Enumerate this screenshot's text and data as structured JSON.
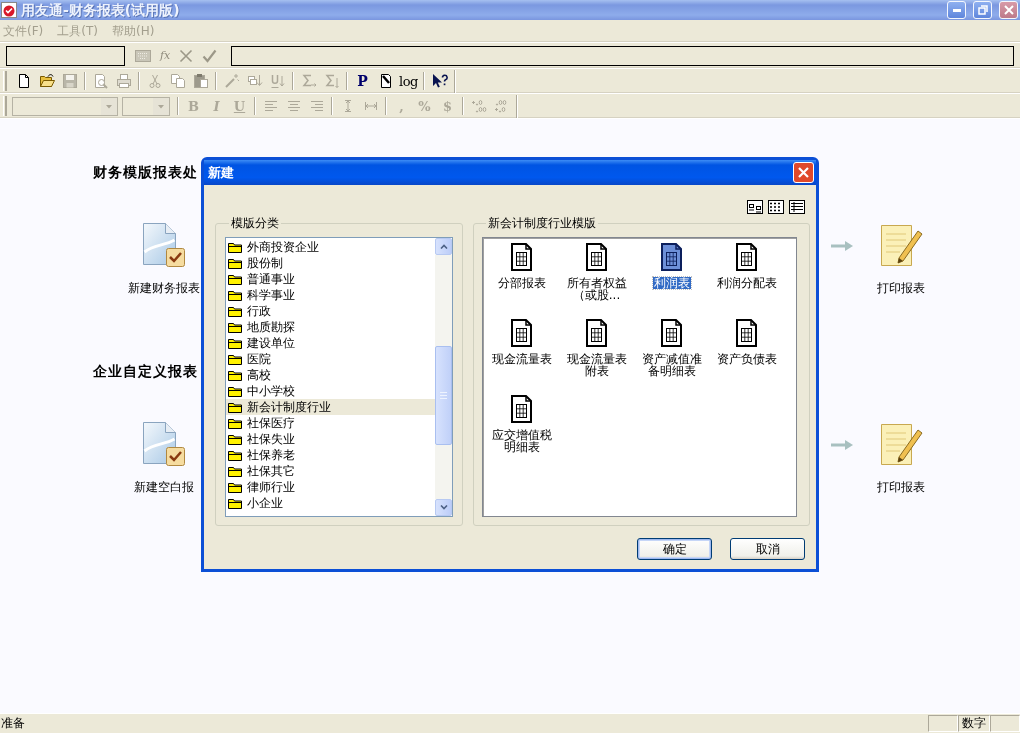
{
  "window": {
    "title": "用友通-财务报表(试用版)",
    "active": false
  },
  "menu": [
    {
      "label": "文件(F)",
      "disabled": true
    },
    {
      "label": "工具(T)",
      "disabled": true
    },
    {
      "label": "帮助(H)",
      "disabled": true
    }
  ],
  "formula_bar": {
    "function_label": "fx",
    "disabled": true
  },
  "standard_toolbar": [
    [
      {
        "kind": "icon",
        "disabled": false
      },
      {
        "kind": "icon",
        "disabled": false
      },
      {
        "kind": "icon",
        "disabled": true
      }
    ],
    [
      {
        "kind": "icon",
        "disabled": true
      },
      {
        "kind": "icon",
        "disabled": true
      }
    ],
    [
      {
        "kind": "icon",
        "disabled": true
      },
      {
        "kind": "icon",
        "disabled": true
      },
      {
        "kind": "icon",
        "disabled": true
      }
    ],
    [
      {
        "kind": "icon",
        "disabled": true
      },
      {
        "kind": "icon",
        "disabled": true
      },
      {
        "kind": "icon",
        "disabled": true
      }
    ],
    [
      {
        "kind": "icon",
        "disabled": true
      },
      {
        "kind": "icon",
        "disabled": true
      }
    ],
    [
      {
        "kind": "text",
        "label": "P",
        "disabled": false
      },
      {
        "kind": "icon",
        "disabled": false
      },
      {
        "kind": "text",
        "label": "log",
        "disabled": false
      }
    ],
    [
      {
        "kind": "icon",
        "disabled": false
      }
    ]
  ],
  "format_toolbar": [
    [
      {
        "kind": "combo",
        "disabled": true
      },
      {
        "kind": "combo",
        "disabled": true
      }
    ],
    [
      {
        "kind": "text",
        "label": "B",
        "disabled": true
      },
      {
        "kind": "text",
        "label": "I",
        "disabled": true
      },
      {
        "kind": "text",
        "label": "U",
        "disabled": true
      }
    ],
    [
      {
        "kind": "icon",
        "disabled": true
      },
      {
        "kind": "icon",
        "disabled": true
      },
      {
        "kind": "icon",
        "disabled": true
      }
    ],
    [
      {
        "kind": "icon",
        "disabled": true
      },
      {
        "kind": "icon",
        "disabled": true
      }
    ],
    [
      {
        "kind": "text",
        "label": ",",
        "disabled": true
      },
      {
        "kind": "text",
        "label": "%",
        "disabled": true
      },
      {
        "kind": "text",
        "label": "$",
        "disabled": true
      }
    ],
    [
      {
        "kind": "icon",
        "disabled": true
      },
      {
        "kind": "icon",
        "disabled": true
      }
    ]
  ],
  "sections": [
    {
      "heading": "财务模版报表处",
      "start_task": "新建财务报表",
      "end_task": "打印报表"
    },
    {
      "heading": "企业自定义报表",
      "start_task": "新建空白报",
      "end_task": "打印报表"
    }
  ],
  "dialog": {
    "title": "新建",
    "category_group": {
      "label": "模版分类",
      "items": [
        {
          "label": "外商投资企业",
          "selected": false
        },
        {
          "label": "股份制",
          "selected": false
        },
        {
          "label": "普通事业",
          "selected": false
        },
        {
          "label": "科学事业",
          "selected": false
        },
        {
          "label": "行政",
          "selected": false
        },
        {
          "label": "地质勘探",
          "selected": false
        },
        {
          "label": "建设单位",
          "selected": false
        },
        {
          "label": "医院",
          "selected": false
        },
        {
          "label": "高校",
          "selected": false
        },
        {
          "label": "中小学校",
          "selected": false
        },
        {
          "label": "新会计制度行业",
          "selected": true
        },
        {
          "label": "社保医疗",
          "selected": false
        },
        {
          "label": "社保失业",
          "selected": false
        },
        {
          "label": "社保养老",
          "selected": false
        },
        {
          "label": "社保其它",
          "selected": false
        },
        {
          "label": "律师行业",
          "selected": false
        },
        {
          "label": "小企业",
          "selected": false
        }
      ]
    },
    "template_group": {
      "label": "新会计制度行业模版",
      "items": [
        {
          "label": "分部报表",
          "selected": false
        },
        {
          "label": "所有者权益（或股...",
          "selected": false
        },
        {
          "label": "利润表",
          "selected": true
        },
        {
          "label": "利润分配表",
          "selected": false
        },
        {
          "label": "现金流量表",
          "selected": false
        },
        {
          "label": "现金流量表附表",
          "selected": false
        },
        {
          "label": "资产减值准备明细表",
          "selected": false
        },
        {
          "label": "资产负债表",
          "selected": false
        },
        {
          "label": "应交增值税明细表",
          "selected": false
        }
      ]
    },
    "buttons": [
      {
        "label": "确定",
        "default": true
      },
      {
        "label": "取消",
        "default": false
      }
    ]
  },
  "status_bar": {
    "message": "准备",
    "panes": [
      {
        "kind": "empty"
      },
      {
        "kind": "text",
        "label": "数字"
      },
      {
        "kind": "empty"
      }
    ]
  }
}
